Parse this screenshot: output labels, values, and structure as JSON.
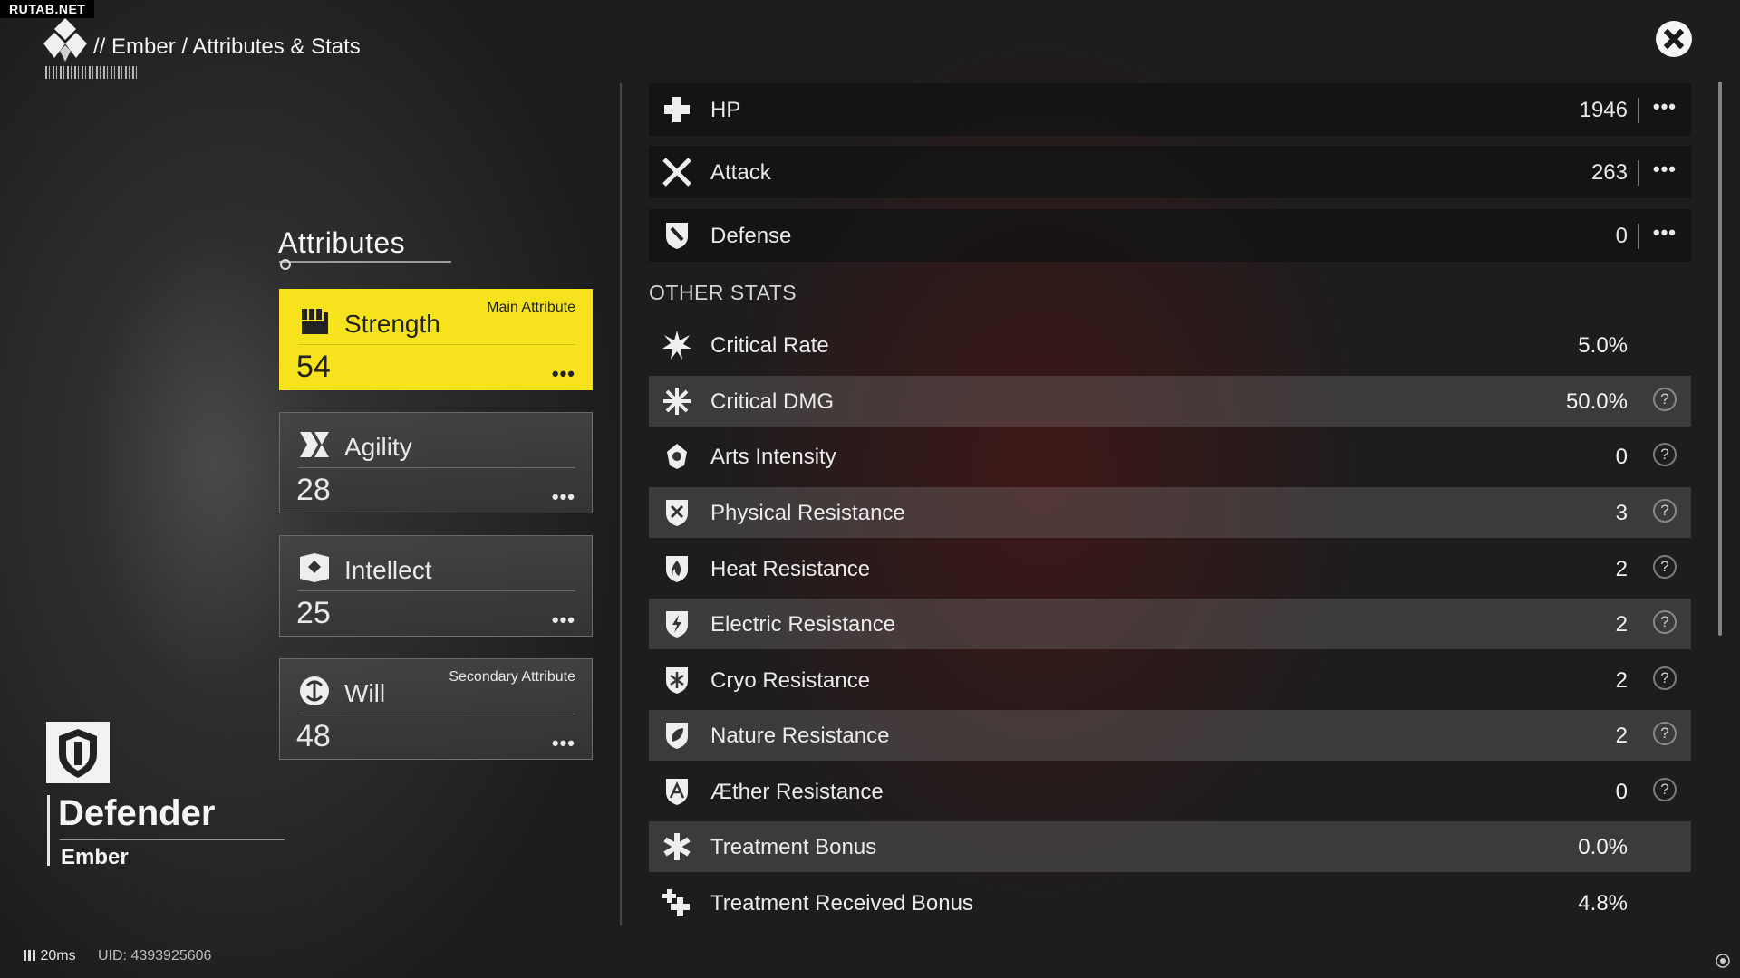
{
  "watermark": "RUTAB.NET",
  "breadcrumb": "// Ember / Attributes & Stats",
  "attributes": {
    "title": "Attributes",
    "cards": [
      {
        "name": "Strength",
        "value": "54",
        "tag": "Main Attribute",
        "icon": "fist-icon",
        "highlight": true
      },
      {
        "name": "Agility",
        "value": "28",
        "tag": "",
        "icon": "agility-icon",
        "highlight": false
      },
      {
        "name": "Intellect",
        "value": "25",
        "tag": "",
        "icon": "intellect-icon",
        "highlight": false
      },
      {
        "name": "Will",
        "value": "48",
        "tag": "Secondary Attribute",
        "icon": "will-icon",
        "highlight": false
      }
    ],
    "more_label": "•••"
  },
  "character": {
    "role": "Defender",
    "name": "Ember",
    "role_icon": "shield-badge-icon"
  },
  "footer": {
    "ping": "20ms",
    "uid": "UID: 4393925606"
  },
  "main_stats": [
    {
      "name": "HP",
      "value": "1946",
      "icon": "cross-icon"
    },
    {
      "name": "Attack",
      "value": "263",
      "icon": "crossed-swords-icon"
    },
    {
      "name": "Defense",
      "value": "0",
      "icon": "shield-icon"
    }
  ],
  "other_stats_heading": "OTHER STATS",
  "other_stats": [
    {
      "name": "Critical Rate",
      "value": "5.0%",
      "help": false,
      "icon": "starburst-icon"
    },
    {
      "name": "Critical DMG",
      "value": "50.0%",
      "help": true,
      "icon": "crit-burst-icon"
    },
    {
      "name": "Arts Intensity",
      "value": "0",
      "help": true,
      "icon": "arts-icon"
    },
    {
      "name": "Physical Resistance",
      "value": "3",
      "help": true,
      "icon": "physical-shield-icon"
    },
    {
      "name": "Heat Resistance",
      "value": "2",
      "help": true,
      "icon": "heat-shield-icon"
    },
    {
      "name": "Electric Resistance",
      "value": "2",
      "help": true,
      "icon": "electric-shield-icon"
    },
    {
      "name": "Cryo Resistance",
      "value": "2",
      "help": true,
      "icon": "cryo-shield-icon"
    },
    {
      "name": "Nature Resistance",
      "value": "2",
      "help": true,
      "icon": "nature-shield-icon"
    },
    {
      "name": "Æther Resistance",
      "value": "0",
      "help": true,
      "icon": "aether-shield-icon"
    },
    {
      "name": "Treatment Bonus",
      "value": "0.0%",
      "help": false,
      "icon": "asterisk-icon"
    },
    {
      "name": "Treatment Received Bonus",
      "value": "4.8%",
      "help": false,
      "icon": "double-cross-icon"
    }
  ],
  "help_label": "?",
  "colors": {
    "accent": "#f6e31e",
    "panel_dark": "#121212",
    "row_shade": "#5a5a5a"
  }
}
